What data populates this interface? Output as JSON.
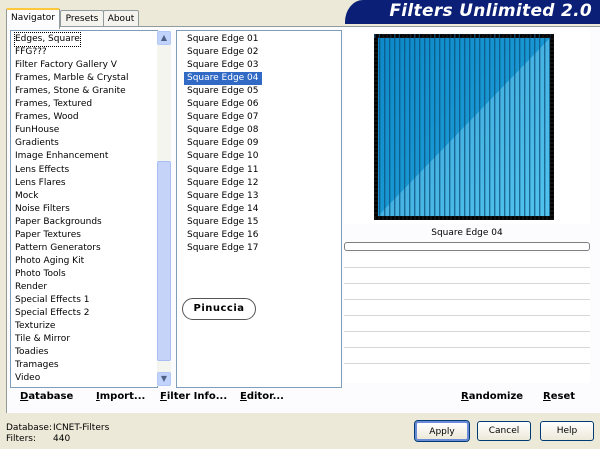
{
  "tabs": [
    {
      "label": "Navigator",
      "active": true
    },
    {
      "label": "Presets",
      "active": false
    },
    {
      "label": "About",
      "active": false
    }
  ],
  "title": "Filters Unlimited 2.0",
  "categories": [
    "Edges, Square",
    "FFG???",
    "Filter Factory Gallery V",
    "Frames, Marble & Crystal",
    "Frames, Stone & Granite",
    "Frames, Textured",
    "Frames, Wood",
    "FunHouse",
    "Gradients",
    "Image Enhancement",
    "Lens Effects",
    "Lens Flares",
    "Mock",
    "Noise Filters",
    "Paper Backgrounds",
    "Paper Textures",
    "Pattern Generators",
    "Photo Aging Kit",
    "Photo Tools",
    "Render",
    "Special Effects 1",
    "Special Effects 2",
    "Texturize",
    "Tile & Mirror",
    "Toadies",
    "Tramages",
    "Video"
  ],
  "selected_category_index": 0,
  "filters": [
    "Square Edge 01",
    "Square Edge 02",
    "Square Edge 03",
    "Square Edge 04",
    "Square Edge 05",
    "Square Edge 06",
    "Square Edge 07",
    "Square Edge 08",
    "Square Edge 09",
    "Square Edge 10",
    "Square Edge 11",
    "Square Edge 12",
    "Square Edge 13",
    "Square Edge 14",
    "Square Edge 15",
    "Square Edge 16",
    "Square Edge 17"
  ],
  "selected_filter_index": 3,
  "watermark": "Pinuccia",
  "preview": {
    "name": "Square Edge 04"
  },
  "bottom_buttons": {
    "database": "Database",
    "import": "Import...",
    "filter_info": "Filter Info...",
    "editor": "Editor...",
    "randomize": "Randomize",
    "reset": "Reset"
  },
  "status": {
    "database_label": "Database:",
    "database_value": "ICNET-Filters",
    "filters_label": "Filters:",
    "filters_value": "440"
  },
  "actions": {
    "apply": "Apply",
    "cancel": "Cancel",
    "help": "Help"
  },
  "colors": {
    "accent": "#316ac5",
    "banner": "#0a1f75",
    "preview_blue": "#1ba6e0"
  },
  "icons": {
    "scroll_up": "chevron-up-icon",
    "scroll_down": "chevron-down-icon"
  }
}
